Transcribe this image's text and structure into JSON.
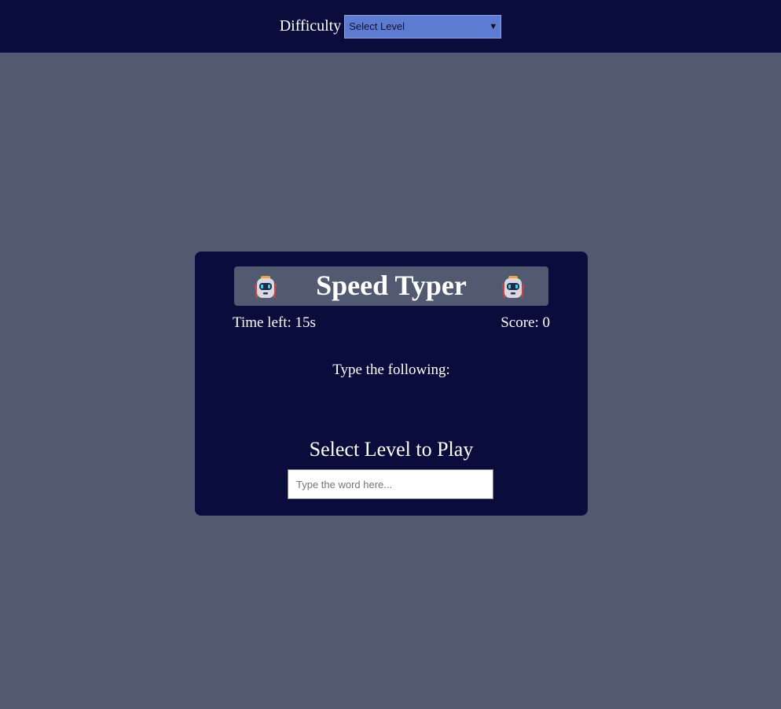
{
  "header": {
    "difficulty_label": "Difficulty",
    "difficulty_select": {
      "selected": "Select Level"
    }
  },
  "game": {
    "title": "Speed Typer",
    "time_left_text": "Time left: 15s",
    "score_text": "Score: 0",
    "prompt_text": "Type the following:",
    "word_text": "Select Level to Play",
    "input": {
      "value": "",
      "placeholder": "Type the word here..."
    },
    "title_icons": [
      "robot-icon",
      "robot-icon"
    ]
  },
  "colors": {
    "background": "#525a71",
    "panel": "#0a0c3c",
    "select_bg": "#5c7bd1",
    "text": "#ffffff"
  }
}
